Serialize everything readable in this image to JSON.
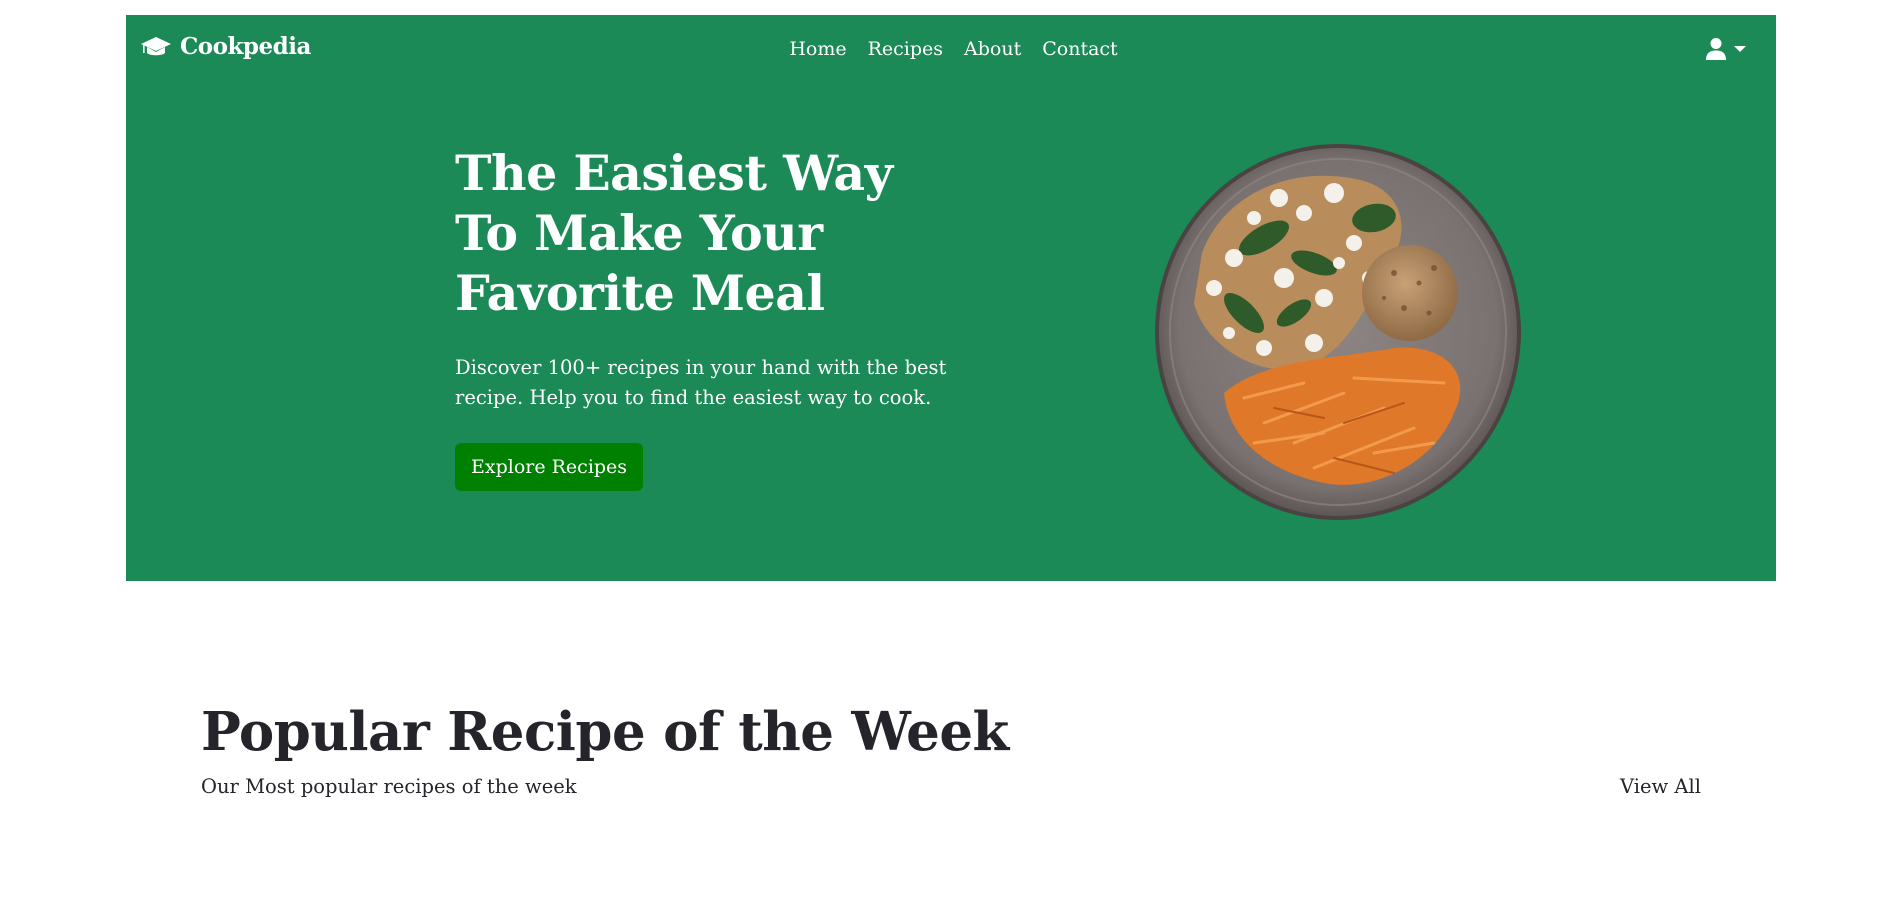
{
  "brand": {
    "name": "Cookpedia",
    "icon": "graduation-cap-icon"
  },
  "nav": {
    "items": [
      {
        "label": "Home"
      },
      {
        "label": "Recipes"
      },
      {
        "label": "About"
      },
      {
        "label": "Contact"
      }
    ],
    "user_icon": "user-icon",
    "caret_icon": "caret-down-icon"
  },
  "hero": {
    "title_lines": [
      "The Easiest Way",
      "To Make Your",
      "Favorite Meal"
    ],
    "subtitle_lines": [
      "Discover 100+ recipes in your hand with the best",
      "recipe. Help you to find the easiest way to cook."
    ],
    "button_label": "Explore Recipes",
    "image_alt": "plate-of-food"
  },
  "popular": {
    "title": "Popular Recipe of the Week",
    "subtitle": "Our Most popular recipes of the week",
    "view_all_label": "View All"
  },
  "colors": {
    "hero_bg": "#1b8a57",
    "button_bg": "#008000",
    "text_dark": "#24242a",
    "white": "#ffffff"
  }
}
